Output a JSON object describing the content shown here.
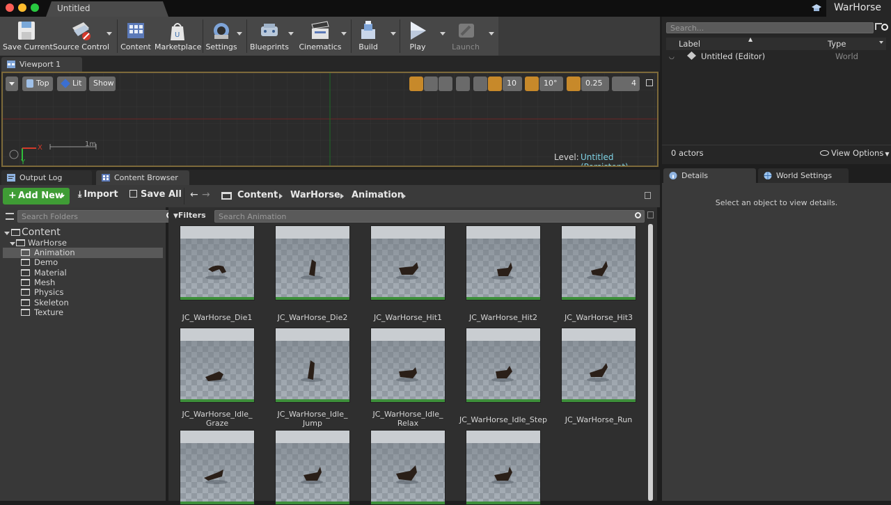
{
  "window": {
    "tab_title": "Untitled",
    "project_name": "WarHorse"
  },
  "toolbar": {
    "buttons": [
      {
        "label": "Save Current",
        "icon": "save-icon"
      },
      {
        "label": "Source Control",
        "icon": "source-control-icon"
      },
      {
        "label": "Content",
        "icon": "content-icon"
      },
      {
        "label": "Marketplace",
        "icon": "marketplace-icon"
      },
      {
        "label": "Settings",
        "icon": "settings-icon"
      },
      {
        "label": "Blueprints",
        "icon": "blueprints-icon"
      },
      {
        "label": "Cinematics",
        "icon": "cinematics-icon"
      },
      {
        "label": "Build",
        "icon": "build-icon"
      },
      {
        "label": "Play",
        "icon": "play-icon"
      },
      {
        "label": "Launch",
        "icon": "launch-icon"
      }
    ]
  },
  "viewport": {
    "tab_label": "Viewport 1",
    "view_mode": "Top",
    "lighting": "Lit",
    "show_label": "Show",
    "grid_snap": "10",
    "rotation_snap": "10°",
    "scale_snap": "0.25",
    "camera_speed": "4",
    "scale_label": "1m",
    "axis_x": "X",
    "axis_y": "Y",
    "level_label": "Level:",
    "level_name": "Untitled (Persistent)"
  },
  "bottom_tabs": {
    "output_log": "Output Log",
    "content_browser": "Content Browser"
  },
  "content_browser": {
    "add_new": "Add New",
    "import": "Import",
    "save_all": "Save All",
    "breadcrumb": [
      "Content",
      "WarHorse",
      "Animation"
    ],
    "folder_search_placeholder": "Search Folders",
    "filters_label": "Filters",
    "asset_search_placeholder": "Search Animation",
    "folders": {
      "root": "Content",
      "project": "WarHorse",
      "children": [
        "Animation",
        "Demo",
        "Material",
        "Mesh",
        "Physics",
        "Skeleton",
        "Texture"
      ],
      "selected": "Animation"
    },
    "assets": [
      {
        "name": "JC_WarHorse_Die1"
      },
      {
        "name": "JC_WarHorse_Die2"
      },
      {
        "name": "JC_WarHorse_Hit1"
      },
      {
        "name": "JC_WarHorse_Hit2"
      },
      {
        "name": "JC_WarHorse_Hit3"
      },
      {
        "name": "JC_WarHorse_Idle_\nGraze"
      },
      {
        "name": "JC_WarHorse_Idle_\nJump"
      },
      {
        "name": "JC_WarHorse_Idle_\nRelax"
      },
      {
        "name": "JC_WarHorse_Idle_Step"
      },
      {
        "name": "JC_WarHorse_Run"
      },
      {
        "name": ""
      },
      {
        "name": ""
      },
      {
        "name": ""
      },
      {
        "name": ""
      }
    ]
  },
  "outliner": {
    "search_placeholder": "Search...",
    "col_label": "Label",
    "col_type": "Type",
    "rows": [
      {
        "label": "Untitled (Editor)",
        "type": "World"
      }
    ],
    "actor_count": "0 actors",
    "view_options": "View Options"
  },
  "details": {
    "tab_details": "Details",
    "tab_world_settings": "World Settings",
    "empty_message": "Select an object to view details."
  },
  "colors": {
    "add_new": "#3f9c35",
    "accent_orange": "#c7892a",
    "level_name": "#7fd3e6"
  }
}
